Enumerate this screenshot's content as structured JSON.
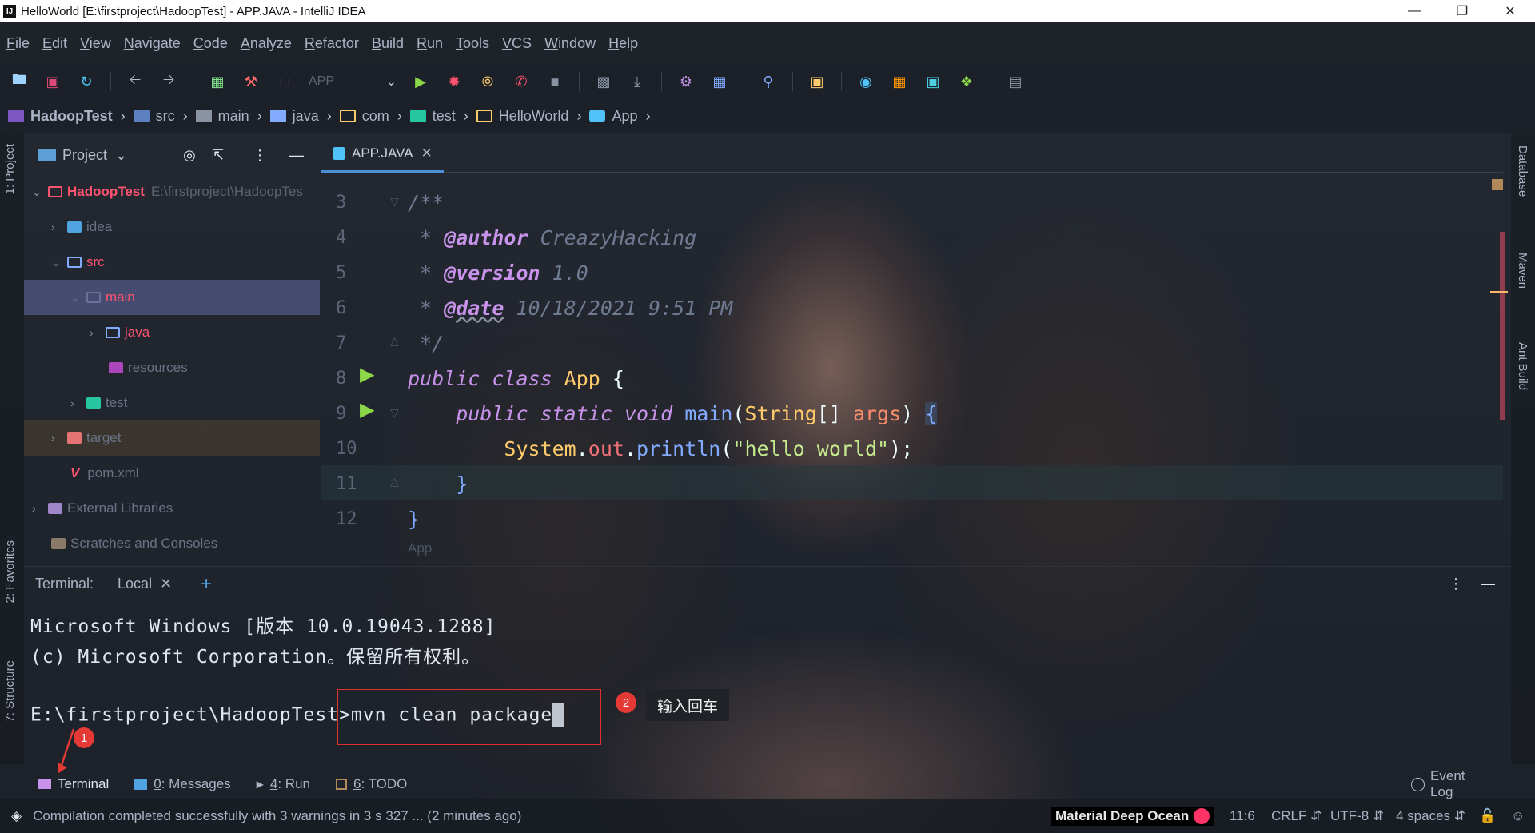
{
  "window": {
    "title": "HelloWorld [E:\\firstproject\\HadoopTest] - APP.JAVA - IntelliJ IDEA"
  },
  "menu": [
    "File",
    "Edit",
    "View",
    "Navigate",
    "Code",
    "Analyze",
    "Refactor",
    "Build",
    "Run",
    "Tools",
    "VCS",
    "Window",
    "Help"
  ],
  "toolbar": {
    "run_config": "APP"
  },
  "breadcrumb": [
    "HadoopTest",
    "src",
    "main",
    "java",
    "com",
    "test",
    "HelloWorld",
    "App"
  ],
  "left_strip": {
    "project_tab": "1: Project",
    "favorites_tab": "2: Favorites",
    "structure_tab": "7: Structure"
  },
  "right_strip": {
    "database_tab": "Database",
    "maven_tab": "Maven",
    "ant_tab": "Ant Build"
  },
  "project_panel": {
    "title": "Project",
    "root_name": "HadoopTest",
    "root_path": "E:\\firstproject\\HadoopTest",
    "items": [
      {
        "label": "idea"
      },
      {
        "label": "src"
      },
      {
        "label": "main"
      },
      {
        "label": "java"
      },
      {
        "label": "resources"
      },
      {
        "label": "test"
      },
      {
        "label": "target"
      },
      {
        "label": "pom.xml"
      },
      {
        "label": "External Libraries"
      },
      {
        "label": "Scratches and Consoles"
      }
    ]
  },
  "editor": {
    "tab_label": "APP.JAVA",
    "line_numbers": [
      "3",
      "4",
      "5",
      "6",
      "7",
      "8",
      "9",
      "10",
      "11",
      "12"
    ],
    "lines": {
      "l3": "/**",
      "l4_star": " * ",
      "l4_tag": "@author",
      "l4_val": " CreazyHacking",
      "l5_star": " * ",
      "l5_tag": "@version",
      "l5_val": " 1.0",
      "l6_star": " * ",
      "l6_tag": "@date",
      "l6_val": " 10/18/2021 9:51 PM",
      "l7": " */",
      "l8_kw": "public class ",
      "l8_cls": "App",
      "l8_rest": " {",
      "l9_kw": "    public static void ",
      "l9_fn": "main",
      "l9_p1": "(",
      "l9_type": "String",
      "l9_p2": "[] ",
      "l9_arg": "args",
      "l9_p3": ") ",
      "l9_brace": "{",
      "l10_cls": "        System",
      "l10_dot1": ".",
      "l10_field": "out",
      "l10_dot2": ".",
      "l10_fn": "println",
      "l10_p1": "(",
      "l10_str": "\"hello world\"",
      "l10_p2": ");",
      "l11": "    }",
      "l12": "}"
    },
    "footer_crumb": "App"
  },
  "terminal": {
    "label": "Terminal:",
    "tab": "Local",
    "lines": [
      "Microsoft Windows [版本 10.0.19043.1288]",
      "(c) Microsoft Corporation。保留所有权利。"
    ],
    "prompt": "E:\\firstproject\\HadoopTest>",
    "command": "mvn clean package"
  },
  "annotations": {
    "badge1": "1",
    "badge2": "2",
    "tooltip": "输入回车"
  },
  "tool_windows": {
    "terminal": "Terminal",
    "messages_num": "0",
    "messages": ": Messages",
    "run_num": "4",
    "run": ": Run",
    "todo_num": "6",
    "todo": ": TODO",
    "event_log": "Event Log"
  },
  "status": {
    "message": "Compilation completed successfully with 3 warnings in 3 s 327 ... (2 minutes ago)",
    "theme": "Material Deep Ocean",
    "position": "11:6",
    "line_sep": "CRLF",
    "encoding": "UTF-8",
    "indent": "4 spaces"
  }
}
